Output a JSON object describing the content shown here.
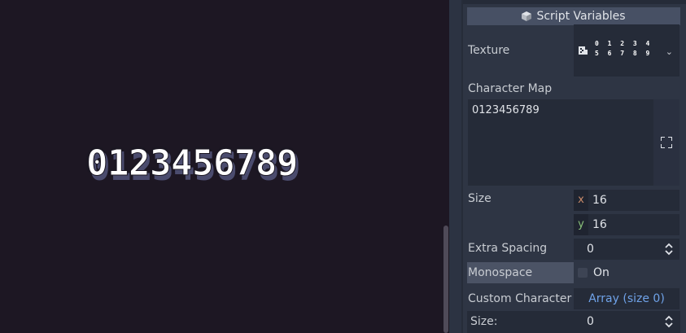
{
  "preview": {
    "text": "0123456789"
  },
  "inspector": {
    "section_title": "Script Variables",
    "texture": {
      "label": "Texture",
      "thumb_row1": "0 1 2 3 4",
      "thumb_row2": "5 6 7 8 9"
    },
    "character_map": {
      "label": "Character Map",
      "value": "0123456789"
    },
    "size": {
      "label": "Size",
      "x_axis": "x",
      "x": "16",
      "y_axis": "y",
      "y": "16"
    },
    "extra_spacing": {
      "label": "Extra Spacing",
      "value": "0"
    },
    "monospace": {
      "label": "Monospace",
      "value": "On"
    },
    "custom_character": {
      "label": "Custom Character",
      "value": "Array (size 0)"
    },
    "array_size": {
      "label": "Size:",
      "value": "0"
    }
  },
  "colors": {
    "x_axis": "#c88a6a",
    "y_axis": "#8ac27a",
    "link": "#6fa2e8"
  }
}
